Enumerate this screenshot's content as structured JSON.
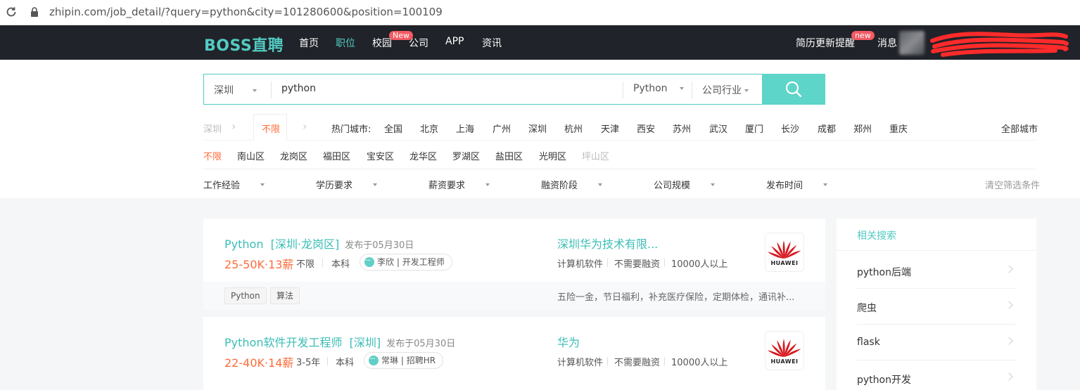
{
  "browser": {
    "url": "zhipin.com/job_detail/?query=python&city=101280600&position=100109"
  },
  "nav": {
    "logo": "BOSS直聘",
    "links": [
      "首页",
      "职位",
      "校园",
      "公司",
      "APP",
      "资讯"
    ],
    "campus_badge": "New",
    "resume_update": "简历更新提醒",
    "resume_badge": "new",
    "messages": "消息"
  },
  "search": {
    "city": "深圳",
    "query": "python",
    "position": "Python",
    "industry": "公司行业"
  },
  "city_row": {
    "current": "深圳",
    "unlimited": "不限",
    "hot_label": "热门城市:",
    "cities": [
      "全国",
      "北京",
      "上海",
      "广州",
      "深圳",
      "杭州",
      "天津",
      "西安",
      "苏州",
      "武汉",
      "厦门",
      "长沙",
      "成都",
      "郑州",
      "重庆"
    ],
    "all_cities": "全部城市"
  },
  "district_row": [
    "不限",
    "南山区",
    "龙岗区",
    "福田区",
    "宝安区",
    "龙华区",
    "罗湖区",
    "盐田区",
    "光明区",
    "坪山区"
  ],
  "filters": {
    "items": [
      "工作经验",
      "学历要求",
      "薪资要求",
      "融资阶段",
      "公司规模",
      "发布时间"
    ],
    "clear": "清空筛选条件"
  },
  "jobs": [
    {
      "title": "Python",
      "area": "[深圳·龙岗区]",
      "published": "发布于05月30日",
      "salary": "25-50K·13薪",
      "experience": "不限",
      "education": "本科",
      "hr_name": "李欣",
      "hr_title": "开发工程师",
      "company": "深圳华为技术有限...",
      "industry": "计算机软件",
      "finance": "不需要融资",
      "size": "10000人以上",
      "logo_text": "HUAWEI",
      "skills": [
        "Python",
        "算法"
      ],
      "welfare": "五险一金，节日福利，补充医疗保险，定期体检，通讯补..."
    },
    {
      "title": "Python软件开发工程师",
      "area": "[深圳]",
      "published": "发布于05月30日",
      "salary": "22-40K·14薪",
      "experience": "3-5年",
      "education": "本科",
      "hr_name": "常琳",
      "hr_title": "招聘HR",
      "company": "华为",
      "industry": "计算机软件",
      "finance": "不需要融资",
      "size": "10000人以上",
      "logo_text": "HUAWEI"
    }
  ],
  "sidebar": {
    "title": "相关搜索",
    "items": [
      "python后端",
      "爬虫",
      "flask",
      "python开发"
    ]
  },
  "colors": {
    "brand": "#53cac3",
    "salary": "#fe6c3b",
    "nav_bg": "#202329",
    "badge": "#f35a63"
  }
}
